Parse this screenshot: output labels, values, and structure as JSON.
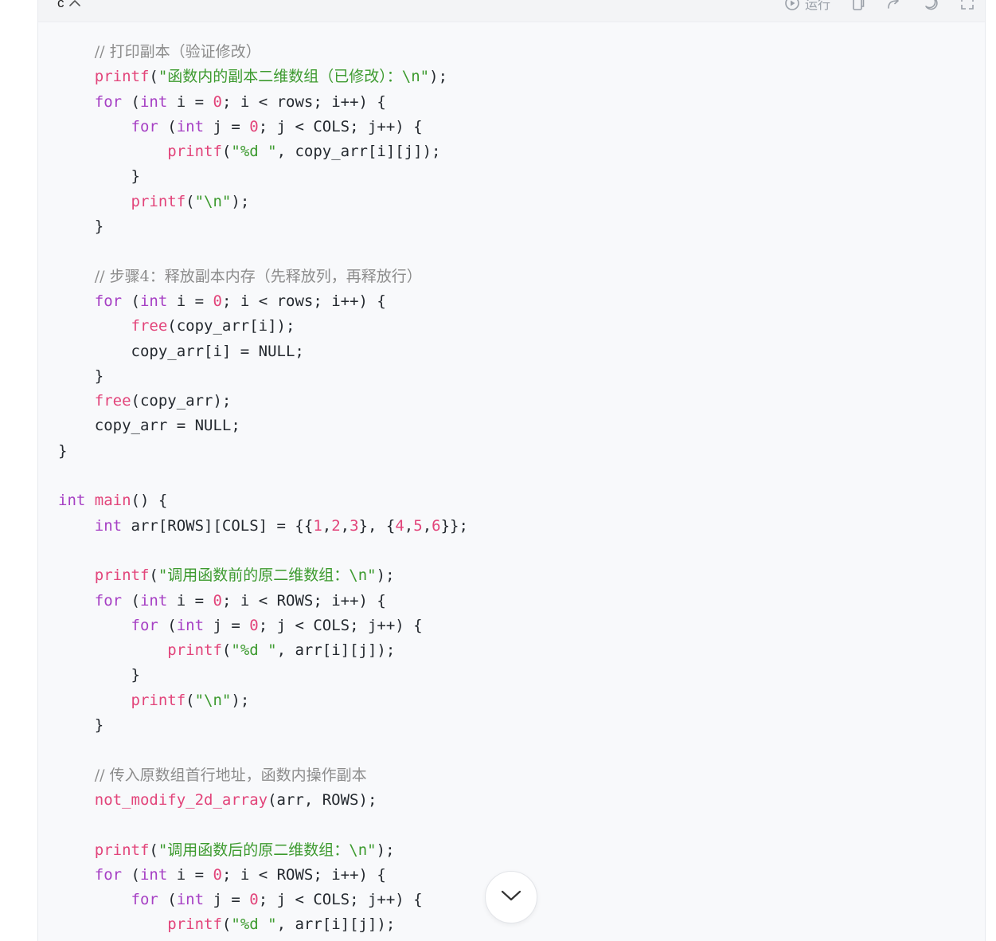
{
  "header": {
    "language": "c",
    "run_label": "运行"
  },
  "code_lines": [
    [
      [
        "",
        "    "
      ],
      [
        "cm",
        "// 打印副本（验证修改）"
      ]
    ],
    [
      [
        "",
        "    "
      ],
      [
        "fn",
        "printf"
      ],
      [
        "",
        "("
      ],
      [
        "st",
        "\"函数内的副本二维数组（已修改）：\\n\""
      ],
      [
        "",
        ");"
      ]
    ],
    [
      [
        "",
        "    "
      ],
      [
        "kw",
        "for"
      ],
      [
        "",
        " ("
      ],
      [
        "kw",
        "int"
      ],
      [
        "",
        " i = "
      ],
      [
        "nu",
        "0"
      ],
      [
        "",
        "; i < rows; i++) {"
      ]
    ],
    [
      [
        "",
        "        "
      ],
      [
        "kw",
        "for"
      ],
      [
        "",
        " ("
      ],
      [
        "kw",
        "int"
      ],
      [
        "",
        " j = "
      ],
      [
        "nu",
        "0"
      ],
      [
        "",
        "; j < COLS; j++) {"
      ]
    ],
    [
      [
        "",
        "            "
      ],
      [
        "fn",
        "printf"
      ],
      [
        "",
        "("
      ],
      [
        "st",
        "\"%d \""
      ],
      [
        "",
        ", copy_arr[i][j]);"
      ]
    ],
    [
      [
        "",
        "        }"
      ]
    ],
    [
      [
        "",
        "        "
      ],
      [
        "fn",
        "printf"
      ],
      [
        "",
        "("
      ],
      [
        "st",
        "\"\\n\""
      ],
      [
        "",
        ");"
      ]
    ],
    [
      [
        "",
        "    }"
      ]
    ],
    [
      [
        "",
        ""
      ]
    ],
    [
      [
        "",
        "    "
      ],
      [
        "cm",
        "// 步骤4：释放副本内存（先释放列，再释放行）"
      ]
    ],
    [
      [
        "",
        "    "
      ],
      [
        "kw",
        "for"
      ],
      [
        "",
        " ("
      ],
      [
        "kw",
        "int"
      ],
      [
        "",
        " i = "
      ],
      [
        "nu",
        "0"
      ],
      [
        "",
        "; i < rows; i++) {"
      ]
    ],
    [
      [
        "",
        "        "
      ],
      [
        "fn",
        "free"
      ],
      [
        "",
        "(copy_arr[i]);"
      ]
    ],
    [
      [
        "",
        "        copy_arr[i] = NULL;"
      ]
    ],
    [
      [
        "",
        "    }"
      ]
    ],
    [
      [
        "",
        "    "
      ],
      [
        "fn",
        "free"
      ],
      [
        "",
        "(copy_arr);"
      ]
    ],
    [
      [
        "",
        "    copy_arr = NULL;"
      ]
    ],
    [
      [
        "",
        "}"
      ]
    ],
    [
      [
        "",
        ""
      ]
    ],
    [
      [
        "kw",
        "int"
      ],
      [
        "",
        " "
      ],
      [
        "fn",
        "main"
      ],
      [
        "",
        "() {"
      ]
    ],
    [
      [
        "",
        "    "
      ],
      [
        "kw",
        "int"
      ],
      [
        "",
        " arr[ROWS][COLS] = {{"
      ],
      [
        "nu",
        "1"
      ],
      [
        "",
        ","
      ],
      [
        "nu",
        "2"
      ],
      [
        "",
        ","
      ],
      [
        "nu",
        "3"
      ],
      [
        "",
        "}, {"
      ],
      [
        "nu",
        "4"
      ],
      [
        "",
        ","
      ],
      [
        "nu",
        "5"
      ],
      [
        "",
        ","
      ],
      [
        "nu",
        "6"
      ],
      [
        "",
        "}};"
      ]
    ],
    [
      [
        "",
        ""
      ]
    ],
    [
      [
        "",
        "    "
      ],
      [
        "fn",
        "printf"
      ],
      [
        "",
        "("
      ],
      [
        "st",
        "\"调用函数前的原二维数组：\\n\""
      ],
      [
        "",
        ");"
      ]
    ],
    [
      [
        "",
        "    "
      ],
      [
        "kw",
        "for"
      ],
      [
        "",
        " ("
      ],
      [
        "kw",
        "int"
      ],
      [
        "",
        " i = "
      ],
      [
        "nu",
        "0"
      ],
      [
        "",
        "; i < ROWS; i++) {"
      ]
    ],
    [
      [
        "",
        "        "
      ],
      [
        "kw",
        "for"
      ],
      [
        "",
        " ("
      ],
      [
        "kw",
        "int"
      ],
      [
        "",
        " j = "
      ],
      [
        "nu",
        "0"
      ],
      [
        "",
        "; j < COLS; j++) {"
      ]
    ],
    [
      [
        "",
        "            "
      ],
      [
        "fn",
        "printf"
      ],
      [
        "",
        "("
      ],
      [
        "st",
        "\"%d \""
      ],
      [
        "",
        ", arr[i][j]);"
      ]
    ],
    [
      [
        "",
        "        }"
      ]
    ],
    [
      [
        "",
        "        "
      ],
      [
        "fn",
        "printf"
      ],
      [
        "",
        "("
      ],
      [
        "st",
        "\"\\n\""
      ],
      [
        "",
        ");"
      ]
    ],
    [
      [
        "",
        "    }"
      ]
    ],
    [
      [
        "",
        ""
      ]
    ],
    [
      [
        "",
        "    "
      ],
      [
        "cm",
        "// 传入原数组首行地址，函数内操作副本"
      ]
    ],
    [
      [
        "",
        "    "
      ],
      [
        "fn",
        "not_modify_2d_array"
      ],
      [
        "",
        "(arr, ROWS);"
      ]
    ],
    [
      [
        "",
        ""
      ]
    ],
    [
      [
        "",
        "    "
      ],
      [
        "fn",
        "printf"
      ],
      [
        "",
        "("
      ],
      [
        "st",
        "\"调用函数后的原二维数组：\\n\""
      ],
      [
        "",
        ");"
      ]
    ],
    [
      [
        "",
        "    "
      ],
      [
        "kw",
        "for"
      ],
      [
        "",
        " ("
      ],
      [
        "kw",
        "int"
      ],
      [
        "",
        " i = "
      ],
      [
        "nu",
        "0"
      ],
      [
        "",
        "; i < ROWS; i++) {"
      ]
    ],
    [
      [
        "",
        "        "
      ],
      [
        "kw",
        "for"
      ],
      [
        "",
        " ("
      ],
      [
        "kw",
        "int"
      ],
      [
        "",
        " j = "
      ],
      [
        "nu",
        "0"
      ],
      [
        "",
        "; j < COLS; j++) {"
      ]
    ],
    [
      [
        "",
        "            "
      ],
      [
        "fn",
        "printf"
      ],
      [
        "",
        "("
      ],
      [
        "st",
        "\"%d \""
      ],
      [
        "",
        ", arr[i][j]);"
      ]
    ]
  ],
  "icons": {
    "run": "play-circle-icon",
    "copy": "copy-icon",
    "share": "share-icon",
    "theme": "moon-icon",
    "expand": "expand-icon",
    "collapse": "chevron-up-icon",
    "scroll": "chevron-down-icon"
  },
  "colors": {
    "keyword": "#a640c4",
    "function": "#e2447a",
    "string": "#3c9a2e",
    "number": "#e2447a",
    "comment": "#8c8c8c"
  }
}
